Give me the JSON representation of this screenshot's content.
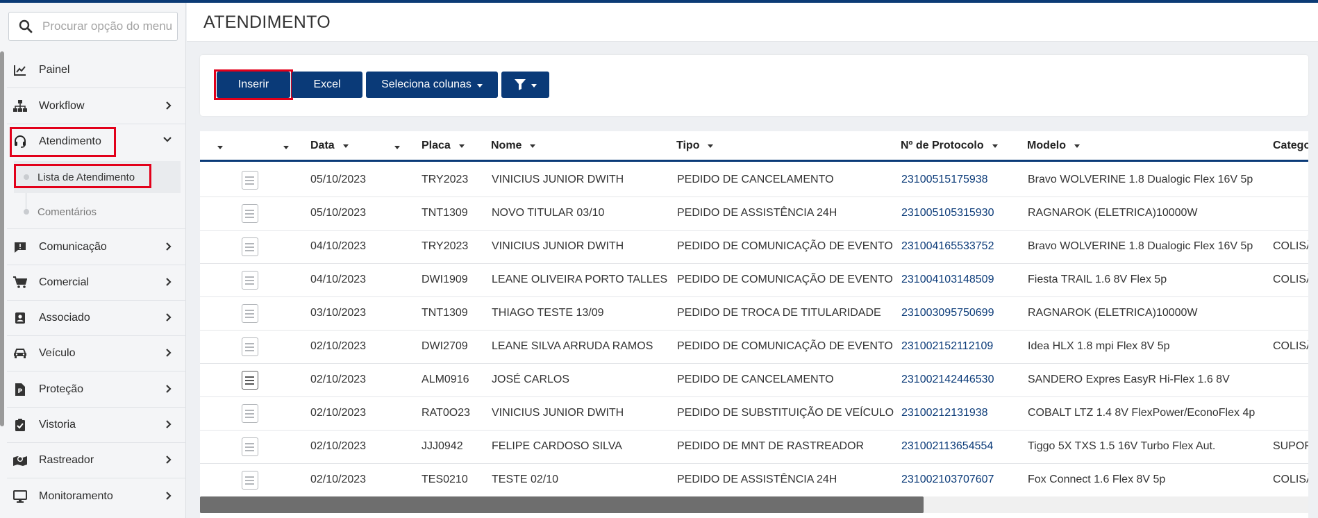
{
  "search": {
    "placeholder": "Procurar opção do menu"
  },
  "sidebar": {
    "items": [
      {
        "label": "Painel",
        "icon": "chart-line-icon"
      },
      {
        "label": "Workflow",
        "icon": "sitemap-icon"
      },
      {
        "label": "Atendimento",
        "icon": "headset-icon"
      },
      {
        "label": "Comunicação",
        "icon": "chat-alert-icon"
      },
      {
        "label": "Comercial",
        "icon": "cart-icon"
      },
      {
        "label": "Associado",
        "icon": "id-badge-icon"
      },
      {
        "label": "Veículo",
        "icon": "car-icon"
      },
      {
        "label": "Proteção",
        "icon": "document-p-icon"
      },
      {
        "label": "Vistoria",
        "icon": "clipboard-check-icon"
      },
      {
        "label": "Rastreador",
        "icon": "map-marker-icon"
      },
      {
        "label": "Monitoramento",
        "icon": "monitor-icon"
      }
    ],
    "subitems": [
      {
        "label": "Lista de Atendimento"
      },
      {
        "label": "Comentários"
      }
    ]
  },
  "page": {
    "title": "ATENDIMENTO"
  },
  "toolbar": {
    "insert_label": "Inserir",
    "excel_label": "Excel",
    "columns_label": "Seleciona colunas"
  },
  "table": {
    "headers": [
      "Data",
      "Placa",
      "Nome",
      "Tipo",
      "Nº de Protocolo",
      "Modelo",
      "Catego"
    ],
    "rows": [
      [
        "05/10/2023",
        "TRY2023",
        "VINICIUS JUNIOR DWITH",
        "PEDIDO DE CANCELAMENTO",
        "23100515175938",
        "Bravo WOLVERINE 1.8 Dualogic Flex 16V 5p",
        ""
      ],
      [
        "05/10/2023",
        "TNT1309",
        "NOVO TITULAR 03/10",
        "PEDIDO DE ASSISTÊNCIA 24H",
        "231005105315930",
        "RAGNAROK (ELETRICA)10000W",
        ""
      ],
      [
        "04/10/2023",
        "TRY2023",
        "VINICIUS JUNIOR DWITH",
        "PEDIDO DE COMUNICAÇÃO DE EVENTO",
        "231004165533752",
        "Bravo WOLVERINE 1.8 Dualogic Flex 16V 5p",
        "COLISÃ"
      ],
      [
        "04/10/2023",
        "DWI1909",
        "LEANE OLIVEIRA PORTO TALLES",
        "PEDIDO DE COMUNICAÇÃO DE EVENTO",
        "231004103148509",
        "Fiesta TRAIL 1.6 8V Flex 5p",
        "COLISÃ"
      ],
      [
        "03/10/2023",
        "TNT1309",
        "THIAGO TESTE 13/09",
        "PEDIDO DE TROCA DE TITULARIDADE",
        "231003095750699",
        "RAGNAROK (ELETRICA)10000W",
        ""
      ],
      [
        "02/10/2023",
        "DWI2709",
        "LEANE SILVA ARRUDA RAMOS",
        "PEDIDO DE COMUNICAÇÃO DE EVENTO",
        "231002152112109",
        "Idea HLX 1.8 mpi Flex 8V 5p",
        "COLISÃ"
      ],
      [
        "02/10/2023",
        "ALM0916",
        "JOSÉ CARLOS",
        "PEDIDO DE CANCELAMENTO",
        "231002142446530",
        "SANDERO Expres EasyR Hi-Flex 1.6 8V",
        ""
      ],
      [
        "02/10/2023",
        "RAT0O23",
        "VINICIUS JUNIOR DWITH",
        "PEDIDO DE SUBSTITUIÇÃO DE VEÍCULO",
        "23100212131938",
        "COBALT LTZ 1.4 8V FlexPower/EconoFlex 4p",
        ""
      ],
      [
        "02/10/2023",
        "JJJ0942",
        "FELIPE CARDOSO SILVA",
        "PEDIDO DE MNT DE RASTREADOR",
        "231002113654554",
        "Tiggo 5X TXS 1.5 16V Turbo Flex Aut.",
        "SUPOF"
      ],
      [
        "02/10/2023",
        "TES0210",
        "TESTE 02/10",
        "PEDIDO DE ASSISTÊNCIA 24H",
        "231002103707607",
        "Fox Connect 1.6 Flex 8V 5p",
        "COLISÃ"
      ]
    ]
  },
  "colors": {
    "primary": "#0a3a78",
    "highlight": "#e2001a",
    "link": "#0a3a78"
  }
}
